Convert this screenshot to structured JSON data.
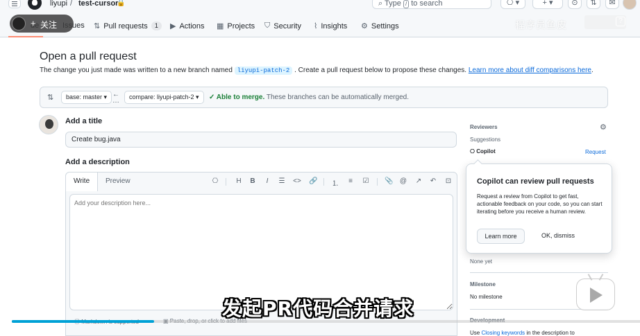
{
  "header": {
    "owner": "liyupi",
    "separator": "/",
    "repo": "test-cursor",
    "lock_glyph": "🔒",
    "search_prefix": "Type",
    "search_key": "/",
    "search_suffix": "to search",
    "plus_glyph": "+ ▾"
  },
  "nav": {
    "code_label": "de",
    "issues_label": "Issues",
    "pull_requests_label": "Pull requests",
    "pull_requests_count": "1",
    "actions_label": "Actions",
    "projects_label": "Projects",
    "security_label": "Security",
    "insights_label": "Insights",
    "settings_label": "Settings"
  },
  "overlay": {
    "follow_plus": "+",
    "follow_label": "关注",
    "watermark": "程序员鱼皮",
    "subtitle": "发起PR代码合并请求",
    "progress": 0.227
  },
  "page": {
    "title": "Open a pull request",
    "desc_before": "The change you just made was written to a new branch named",
    "branch_name": "liyupi-patch-2",
    "desc_after": ". Create a pull request below to propose these changes.",
    "desc_link": "Learn more about diff comparisons here",
    "desc_end": "."
  },
  "compare": {
    "base_label": "base: master ▾",
    "compare_label": "compare: liyupi-patch-2 ▾",
    "merge_ok": "✓ Able to merge.",
    "merge_text": "These branches can be automatically merged."
  },
  "form": {
    "title_label": "Add a title",
    "title_value": "Create bug.java",
    "description_label": "Add a description",
    "tab_write": "Write",
    "tab_preview": "Preview",
    "description_placeholder": "Add your description here...",
    "markdown_note": "Markdown is supported",
    "attach_note": "Paste, drop, or click to add files"
  },
  "toolbar": {
    "copilot_icon": "⎔",
    "heading_icon": "H",
    "bold_icon": "B",
    "italic_icon": "I",
    "quote_icon": "☰",
    "code_icon": "<>",
    "link_icon": "🔗",
    "ordered_list_icon": "⒈",
    "unordered_list_icon": "≡",
    "task_list_icon": "☑",
    "attach_icon": "📎",
    "mention_icon": "@",
    "reference_icon": "↗",
    "undo_icon": "↶",
    "fullscreen_icon": "⊡"
  },
  "sidebar": {
    "reviewers_heading": "Reviewers",
    "suggestions_label": "Suggestions",
    "copilot_label": "Copilot",
    "request_link": "Request",
    "none_yet": "None yet",
    "milestone_heading": "Milestone",
    "no_milestone": "No milestone",
    "development_heading": "Development",
    "development_before": "Use",
    "development_link": "Closing keywords",
    "development_after": "in the description to"
  },
  "popover": {
    "title": "Copilot can review pull requests",
    "body": "Request a review from Copilot to get fast, actionable feedback on your code, so you can start iterating before you receive a human review.",
    "learn_more": "Learn more",
    "dismiss": "OK, dismiss"
  },
  "colors": {
    "link": "#0969da",
    "success": "#1a7f37",
    "border": "#d1d9e0",
    "active_tab_underline": "#fd8c73",
    "progress": "#00a1d6"
  }
}
